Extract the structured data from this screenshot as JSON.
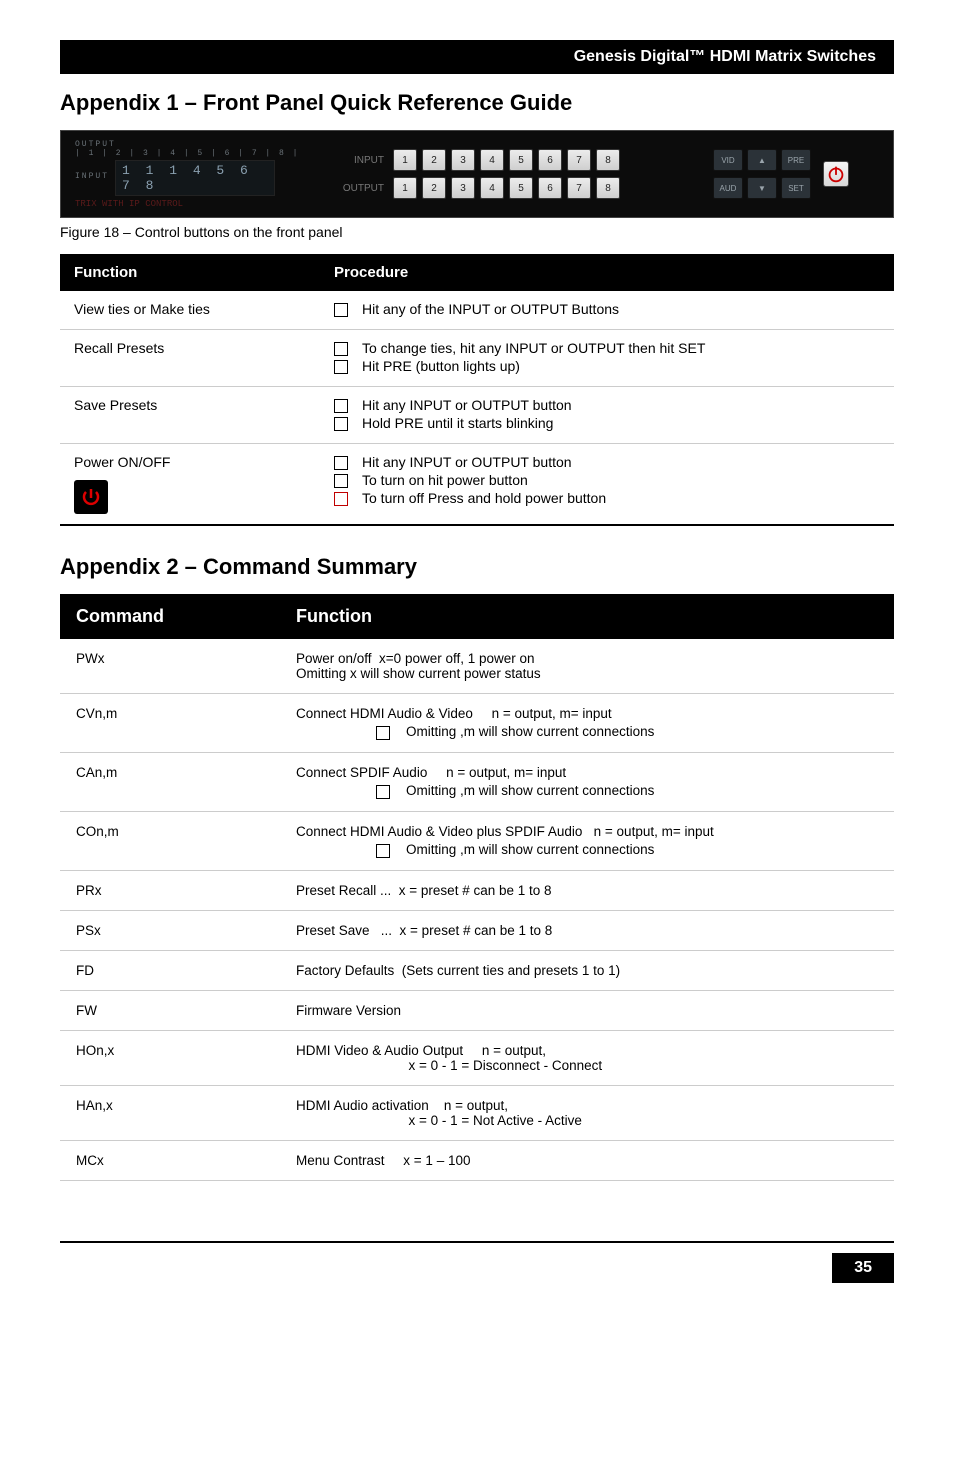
{
  "header_title": "Genesis Digital™ HDMI Matrix Switches",
  "appendix1_title": "Appendix 1 – Front Panel Quick Reference Guide",
  "panel": {
    "output_label": "OUTPUT",
    "output_grid": "| 1 | 2 | 3 | 4 | 5 | 6 | 7 | 8 |",
    "input_label": "INPUT",
    "lcd_text": "1 1 1 4 5 6 7 8",
    "ip_text": "TRIX WITH IP CONTROL",
    "row_input_label": "INPUT",
    "row_output_label": "OUTPUT",
    "nums": [
      "1",
      "2",
      "3",
      "4",
      "5",
      "6",
      "7",
      "8"
    ],
    "vid": "VID",
    "pre": "PRE",
    "aud": "AUD",
    "set": "SET",
    "up": "▲",
    "down": "▼"
  },
  "figure_caption": "Figure 18 – Control buttons on the front panel",
  "func_header": {
    "col1": "Function",
    "col2": "Procedure"
  },
  "func_rows": [
    {
      "label": "View ties or Make ties",
      "bullets": [
        "Hit any of the INPUT or OUTPUT Buttons"
      ]
    },
    {
      "label": "Recall Presets",
      "bullets": [
        "To change ties, hit any INPUT or OUTPUT then hit SET",
        "Hit PRE (button lights up)"
      ]
    },
    {
      "label": "Save Presets",
      "bullets": [
        "Hit any INPUT or OUTPUT button",
        "Hold PRE until it starts blinking"
      ]
    },
    {
      "label": "Power ON/OFF",
      "bullets": [
        "Hit any INPUT or OUTPUT button",
        "To turn on hit power button"
      ],
      "red_bullet": "To turn off Press and hold power button",
      "has_power_icon": true
    }
  ],
  "appendix2_title": "Appendix 2 – Command Summary",
  "cmd_header": {
    "col1": "Command",
    "col2": "Function"
  },
  "cmd_rows": [
    {
      "cmd": "PWx",
      "lines": [
        "Power on/off  x=0 power off, 1 power on",
        "Omitting x will show current power status"
      ]
    },
    {
      "cmd": "CVn,m",
      "lines": [
        "Connect HDMI Audio & Video     n = output, m= input"
      ],
      "sub_bullet": "Omitting ,m will show current connections"
    },
    {
      "cmd": "CAn,m",
      "lines": [
        "Connect SPDIF Audio     n = output, m= input"
      ],
      "sub_bullet": "Omitting ,m will show current connections"
    },
    {
      "cmd": "COn,m",
      "lines": [
        "Connect HDMI Audio & Video plus SPDIF Audio   n = output, m= input"
      ],
      "sub_bullet": "Omitting ,m will show current connections"
    },
    {
      "cmd": "PRx",
      "lines": [
        "Preset Recall ...  x = preset # can be 1 to 8"
      ]
    },
    {
      "cmd": "PSx",
      "lines": [
        "Preset Save   ...  x = preset # can be 1 to 8"
      ]
    },
    {
      "cmd": "FD",
      "lines": [
        "Factory Defaults  (Sets current ties and presets 1 to 1)"
      ]
    },
    {
      "cmd": "FW",
      "lines": [
        "Firmware Version"
      ]
    },
    {
      "cmd": "HOn,x",
      "lines": [
        "HDMI Video & Audio Output     n = output,",
        "                              x = 0 - 1 = Disconnect - Connect"
      ]
    },
    {
      "cmd": "HAn,x",
      "lines": [
        "HDMI Audio activation    n = output,",
        "                              x = 0 - 1 = Not Active - Active"
      ]
    },
    {
      "cmd": "MCx",
      "lines": [
        "Menu Contrast     x = 1 – 100"
      ]
    }
  ],
  "page_number": "35"
}
